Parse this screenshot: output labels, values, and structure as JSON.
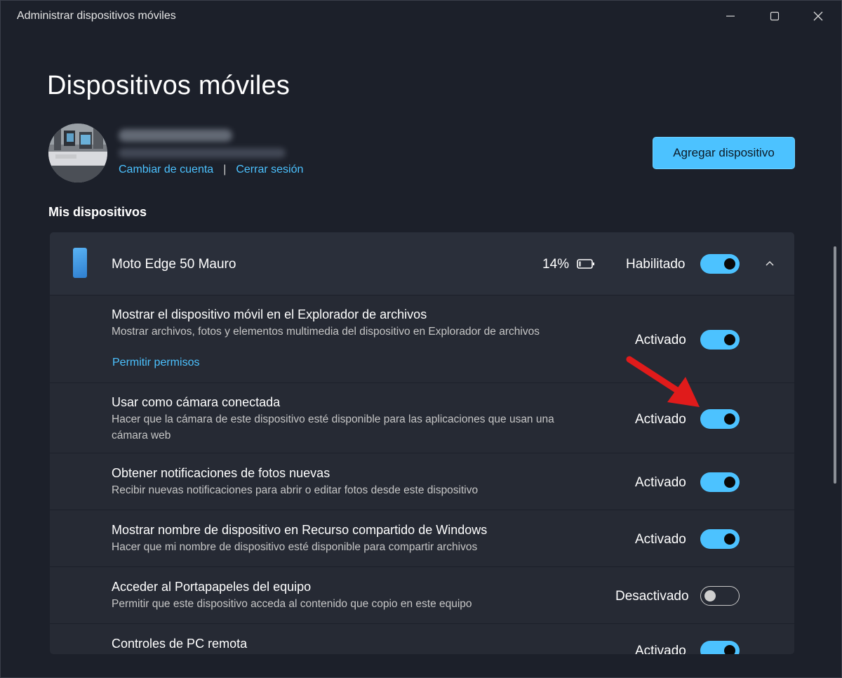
{
  "window": {
    "title": "Administrar dispositivos móviles"
  },
  "header": {
    "title": "Dispositivos móviles",
    "change_account": "Cambiar de cuenta",
    "separator": "|",
    "sign_out": "Cerrar sesión",
    "add_device": "Agregar dispositivo"
  },
  "section": {
    "title": "Mis dispositivos"
  },
  "device": {
    "name": "Moto Edge 50 Mauro",
    "battery": "14%",
    "status": "Habilitado",
    "enabled": true
  },
  "settings": [
    {
      "title": "Mostrar el dispositivo móvil en el Explorador de archivos",
      "description": "Mostrar archivos, fotos y elementos multimedia del dispositivo en Explorador de archivos",
      "link": "Permitir permisos",
      "state": "Activado",
      "on": true
    },
    {
      "title": "Usar como cámara conectada",
      "description": "Hacer que la cámara de este dispositivo esté disponible para las aplicaciones que usan una cámara web",
      "state": "Activado",
      "on": true
    },
    {
      "title": "Obtener notificaciones de fotos nuevas",
      "description": "Recibir nuevas notificaciones para abrir o editar fotos desde este dispositivo",
      "state": "Activado",
      "on": true
    },
    {
      "title": "Mostrar nombre de dispositivo en Recurso compartido de Windows",
      "description": "Hacer que mi nombre de dispositivo esté disponible para compartir archivos",
      "state": "Activado",
      "on": true
    },
    {
      "title": "Acceder al Portapapeles del equipo",
      "description": "Permitir que este dispositivo acceda al contenido que copio en este equipo",
      "state": "Desactivado",
      "on": false
    },
    {
      "title": "Controles de PC remota",
      "state": "Activado",
      "on": true
    }
  ],
  "colors": {
    "accent": "#4cc2ff",
    "background": "#1c202a",
    "card": "#262a34",
    "annotation_arrow": "#e01b1b"
  }
}
